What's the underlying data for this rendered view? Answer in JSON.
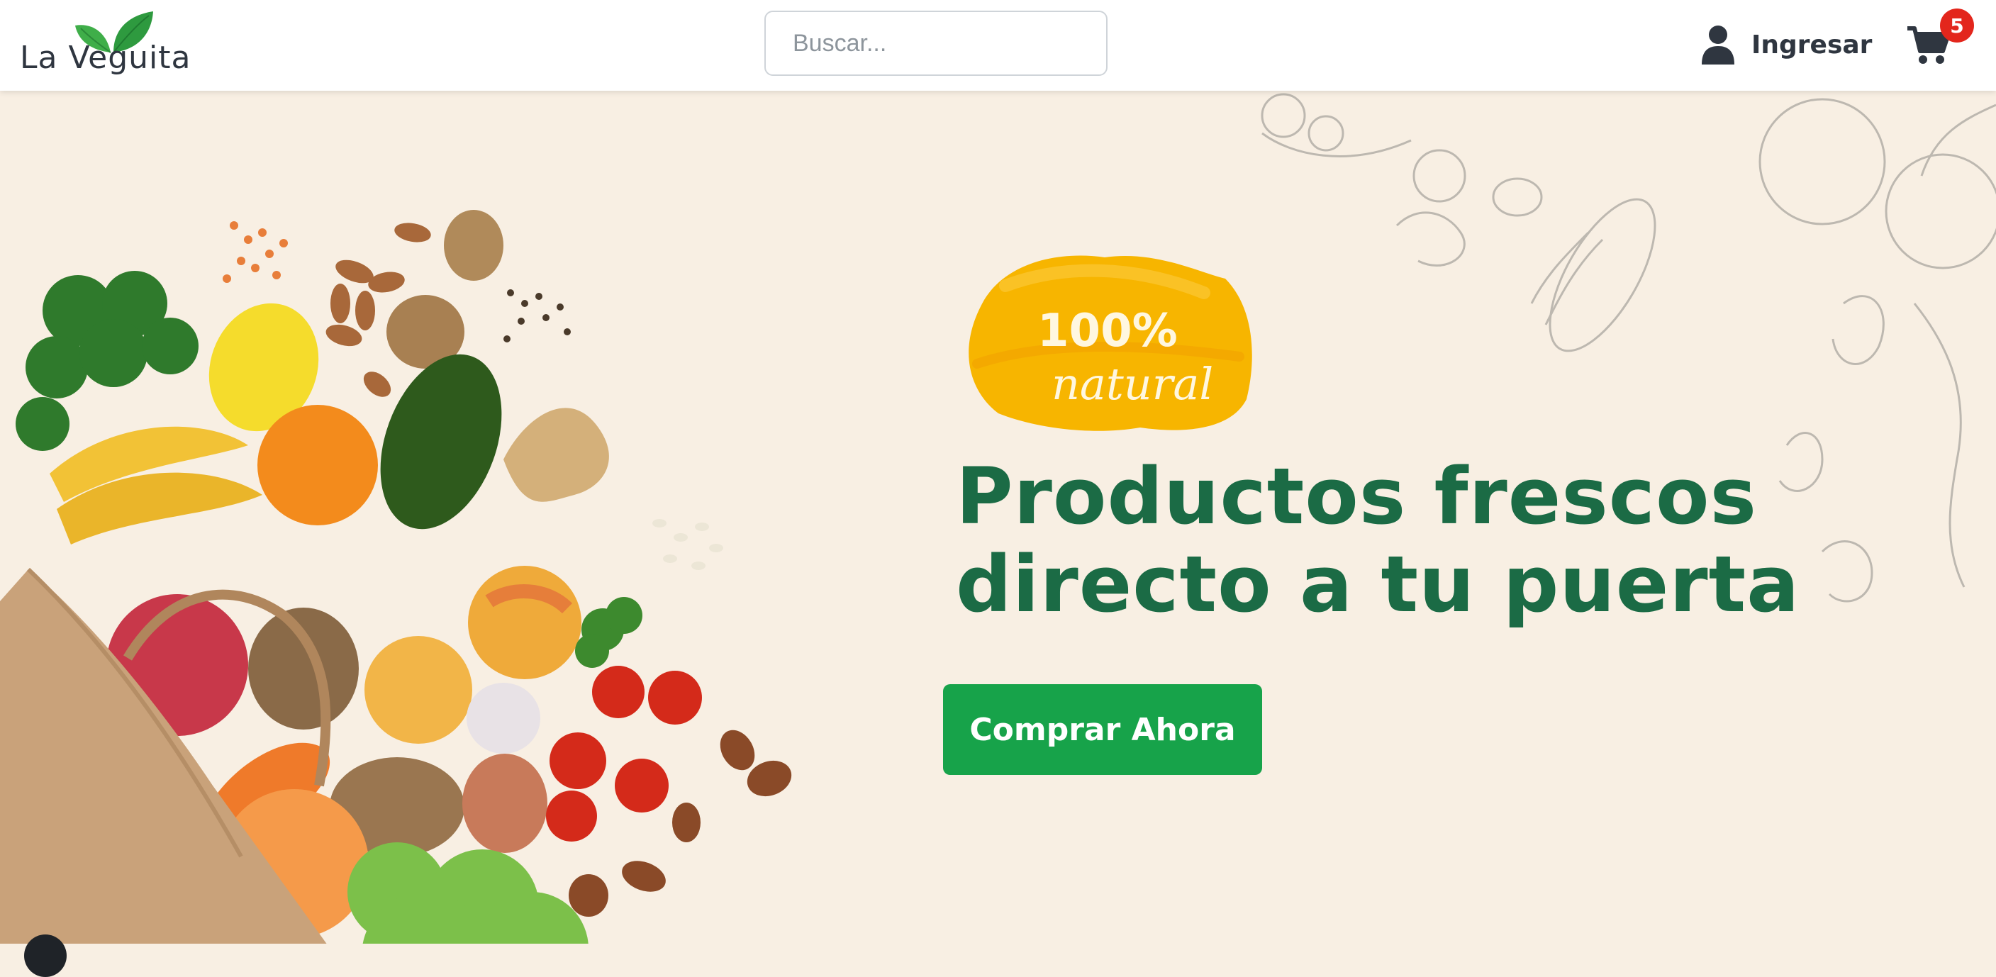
{
  "header": {
    "logo_text": "La Veguita",
    "search_placeholder": "Buscar...",
    "login_label": "Ingresar",
    "cart_count": "5"
  },
  "hero": {
    "badge_line1": "100%",
    "badge_line2": "natural",
    "headline_line1": "Productos frescos",
    "headline_line2": "directo a tu puerta",
    "cta_label": "Comprar Ahora"
  },
  "colors": {
    "background": "#f8efe3",
    "headline_green": "#1b6b45",
    "cta_green": "#17a34a",
    "badge_red": "#e3261c",
    "badge_yellow": "#f7b500",
    "text_dark": "#2f3640"
  },
  "icons": [
    "leaf-logo-icon",
    "user-icon",
    "shopping-cart-icon"
  ]
}
